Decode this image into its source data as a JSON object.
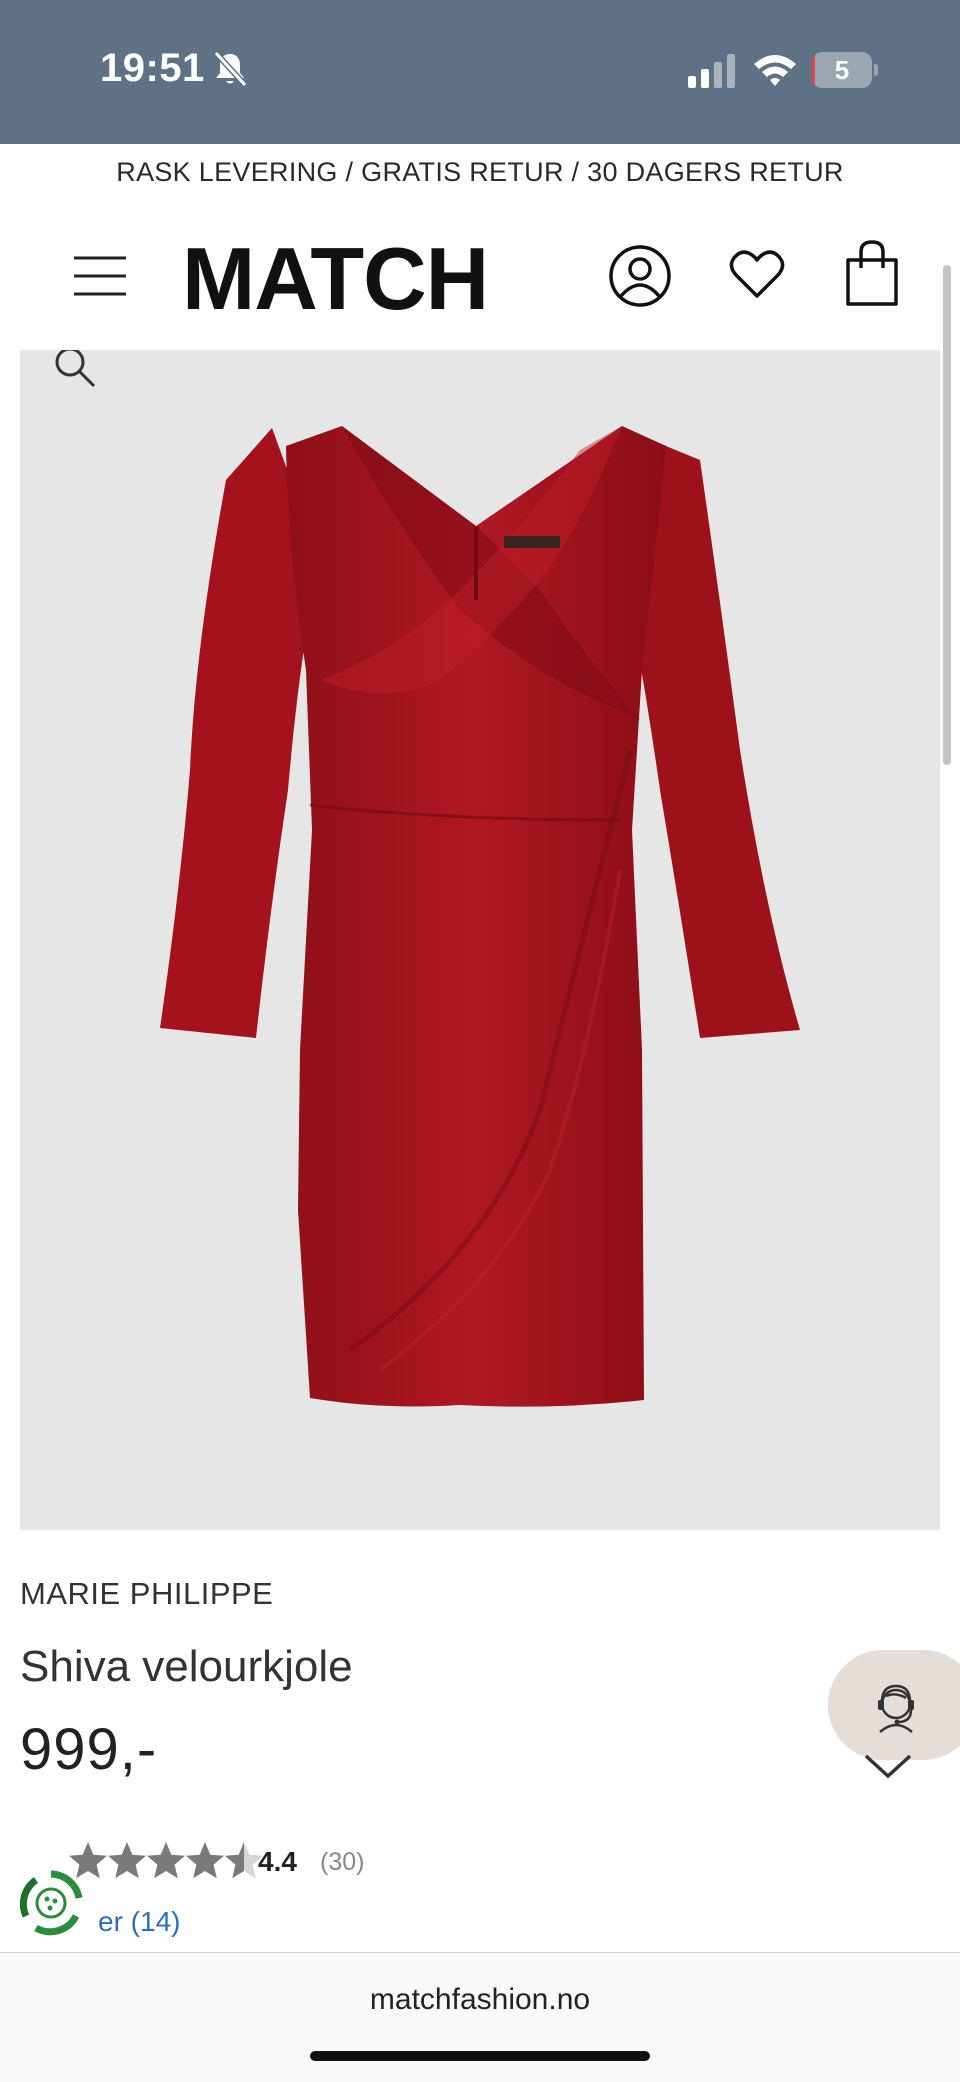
{
  "status_bar": {
    "time": "19:51",
    "battery_level": "5",
    "battery_fraction": 0.05,
    "icons": [
      "bell-slash-icon",
      "signal-icon",
      "wifi-icon",
      "battery-icon"
    ]
  },
  "promo_banner": "RASK LEVERING / GRATIS RETUR / 30 DAGERS RETUR",
  "header": {
    "logo": "MATCH",
    "icons": [
      "menu-icon",
      "account-icon",
      "heart-icon",
      "bag-icon"
    ]
  },
  "product": {
    "brand": "MARIE PHILIPPE",
    "name": "Shiva velourkjole",
    "price": "999,-",
    "dress_color": "#a3121d",
    "image_bg": "#e6e6e6"
  },
  "rating": {
    "value": "4.4",
    "count": "(30)",
    "stars_filled": 4.5,
    "stars_max": 5,
    "reviews_link": "er (14)"
  },
  "browser": {
    "url": "matchfashion.no"
  },
  "colors": {
    "status_bar_bg": "#5f7285",
    "link": "#2f6fb5",
    "chat_bg": "#e4ddd8",
    "eco_green": "#2e8b3a"
  }
}
